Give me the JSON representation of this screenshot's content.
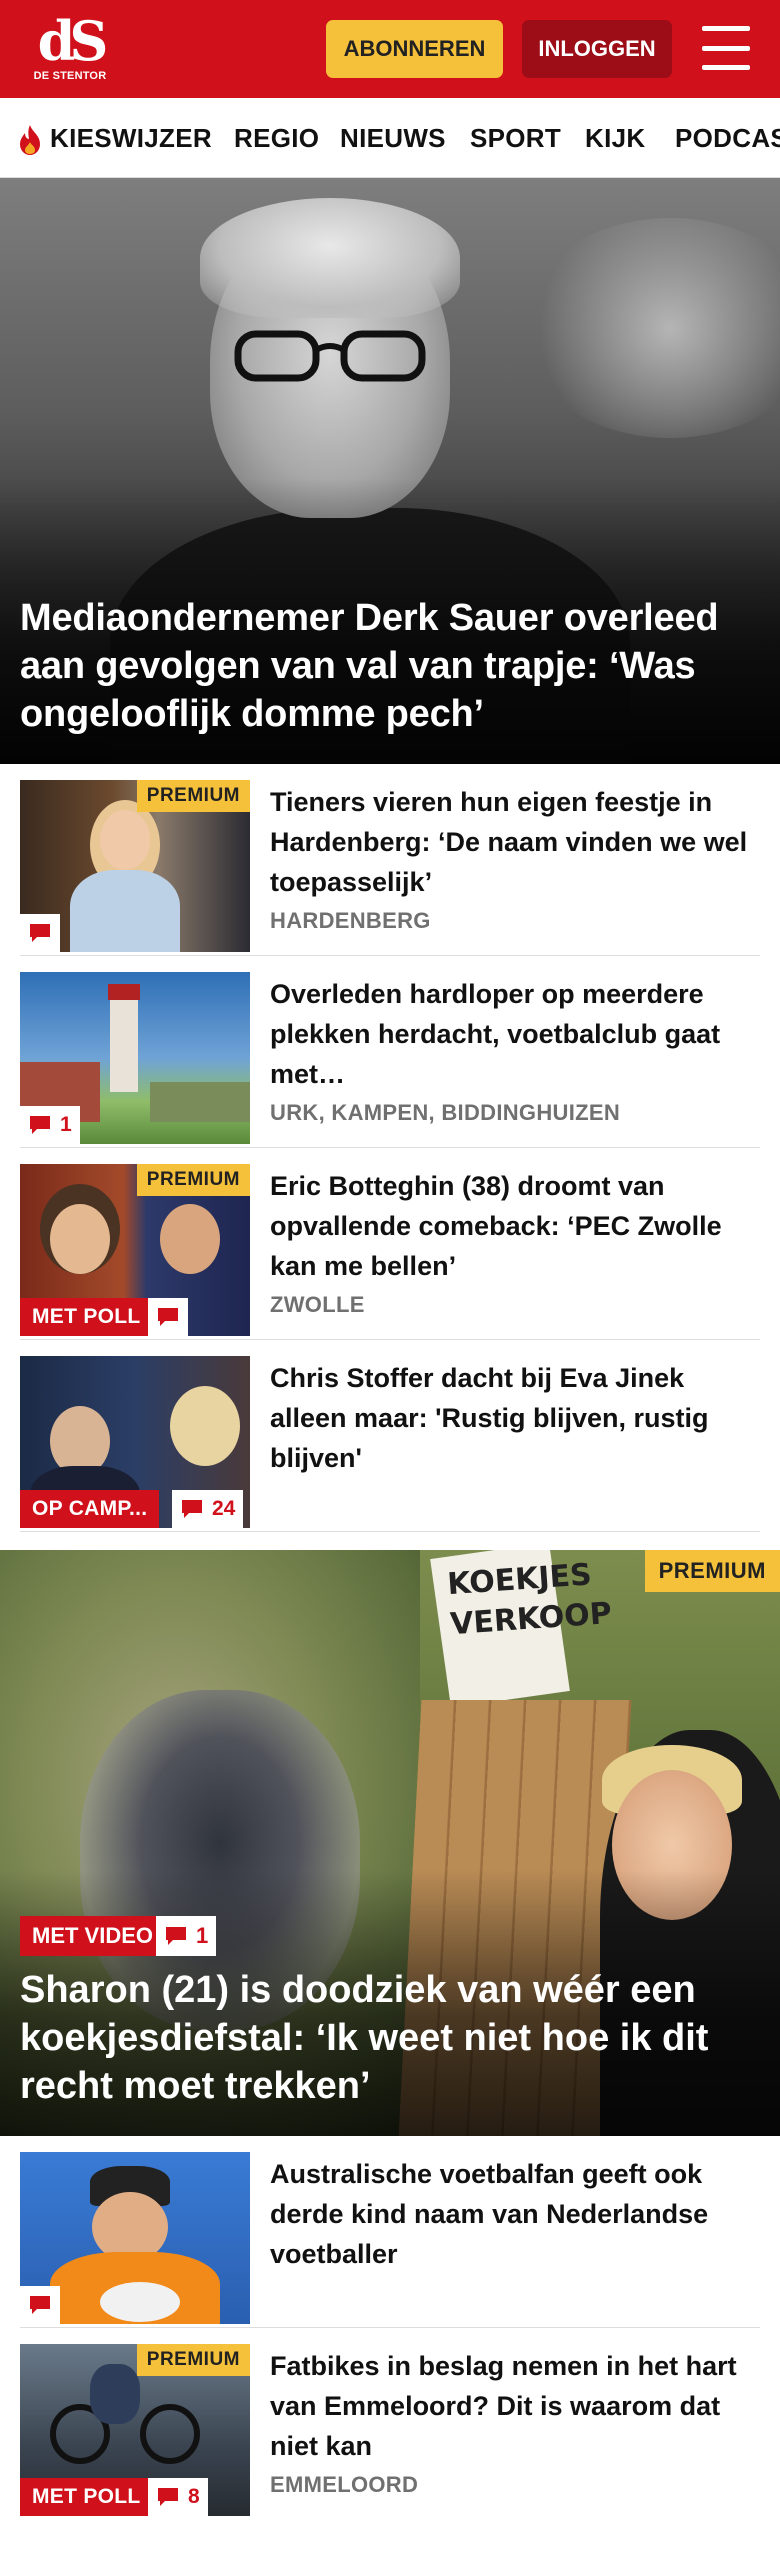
{
  "header": {
    "logo_mark": "dS",
    "logo_sub": "DE STENTOR",
    "subscribe_label": "ABONNEREN",
    "login_label": "INLOGGEN",
    "brand_color": "#d0111b",
    "menu_icon": "hamburger-icon"
  },
  "nav": {
    "items": [
      {
        "label": "KIESWIJZER",
        "icon": "flame-icon"
      },
      {
        "label": "REGIO"
      },
      {
        "label": "NIEUWS"
      },
      {
        "label": "SPORT"
      },
      {
        "label": "KIJK"
      },
      {
        "label": "PODCAS"
      }
    ]
  },
  "hero": {
    "title": "Mediaondernemer Derk Sauer overleed aan gevolgen van val van trapje: ‘Was ongelooflijk domme pech’"
  },
  "articles": [
    {
      "title": "Tieners vieren hun eigen feestje in Hardenberg: ‘De naam vinden we wel toepasselijk’",
      "location": "HARDENBERG",
      "badge": "PREMIUM",
      "comment_count": ""
    },
    {
      "title": "Overleden hardloper op meerdere plekken herdacht, voetbalclub gaat met…",
      "location": "URK, KAMPEN, BIDDINGHUIZEN",
      "comment_count": "1"
    },
    {
      "title": "Eric Botteghin (38) droomt van opvallende comeback: ‘PEC Zwolle kan me bellen’",
      "location": "ZWOLLE",
      "badge": "PREMIUM",
      "tag": "MET POLL",
      "comment_count": ""
    },
    {
      "title": "Chris Stoffer dacht bij Eva Jinek alleen maar: 'Rustig blijven, rustig blijven'",
      "location": "",
      "tag": "OP CAMP...",
      "comment_count": "24"
    }
  ],
  "hero2": {
    "badge": "PREMIUM",
    "tag": "MET VIDEO",
    "comment_count": "1",
    "sign_text": "KOEKJES VERKOOP",
    "title": "Sharon (21) is doodziek van wéér een koekjesdiefstal: ‘Ik weet niet hoe ik dit recht moet trekken’"
  },
  "articles2": [
    {
      "title": "Australische voetbalfan geeft ook derde kind naam van Nederlandse voetballer",
      "location": "",
      "comment_count": ""
    },
    {
      "title": "Fatbikes in beslag nemen in het hart van Emmeloord? Dit is waarom dat niet kan",
      "location": "EMMELOORD",
      "badge": "PREMIUM",
      "tag": "MET POLL",
      "comment_count": "8"
    }
  ]
}
